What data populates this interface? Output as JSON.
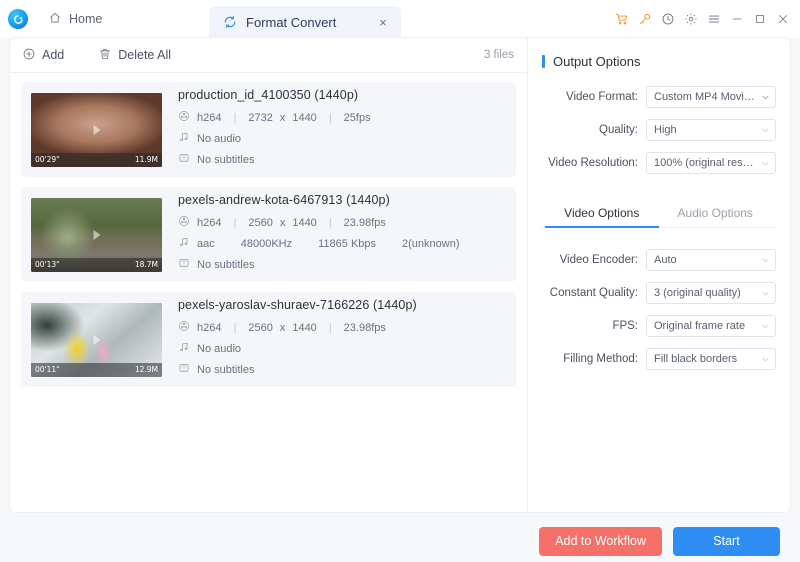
{
  "titlebar": {
    "logo_icon": "app-logo-icon",
    "home_label": "Home",
    "home_icon": "home-icon",
    "tab": {
      "icon": "convert-refresh-icon",
      "label": "Format Convert",
      "close_icon": "close-icon",
      "close_glyph": "×"
    },
    "window_icons": [
      {
        "name": "cart-icon",
        "color": "#f0922b"
      },
      {
        "name": "key-icon",
        "color": "#f0922b"
      },
      {
        "name": "history-clock-icon",
        "color": "#6a7180"
      },
      {
        "name": "gear-icon",
        "color": "#6a7180"
      },
      {
        "name": "menu-icon",
        "color": "#6a7180"
      },
      {
        "name": "minimize-icon",
        "color": "#6a7180"
      },
      {
        "name": "maximize-icon",
        "color": "#6a7180"
      },
      {
        "name": "window-close-icon",
        "color": "#6a7180"
      }
    ]
  },
  "toolbar": {
    "add_label": "Add",
    "add_icon": "plus-circle-icon",
    "delete_all_label": "Delete All",
    "delete_all_icon": "trash-icon",
    "file_count": "3 files"
  },
  "files": [
    {
      "name": "production_id_4100350 (1440p)",
      "duration": "00'29\"",
      "size": "11.9M",
      "video": {
        "codec": "h264",
        "width": "2732",
        "height": "1440",
        "fps": "25fps"
      },
      "audio_text": "No audio",
      "subtitle_text": "No subtitles",
      "thumb_colors": [
        "#1d1613",
        "#b08a76",
        "#4b2e22"
      ]
    },
    {
      "name": "pexels-andrew-kota-6467913 (1440p)",
      "duration": "00'13\"",
      "size": "18.7M",
      "video": {
        "codec": "h264",
        "width": "2560",
        "height": "1440",
        "fps": "23.98fps"
      },
      "audio": {
        "codec": "aac",
        "sample_rate": "48000KHz",
        "bitrate": "11865 Kbps",
        "channels": "2(unknown)"
      },
      "subtitle_text": "No subtitles",
      "thumb_colors": [
        "#4a5a3e",
        "#7d8d6a",
        "#2f3a28"
      ]
    },
    {
      "name": "pexels-yaroslav-shuraev-7166226 (1440p)",
      "duration": "00'11\"",
      "size": "12.9M",
      "video": {
        "codec": "h264",
        "width": "2560",
        "height": "1440",
        "fps": "23.98fps"
      },
      "audio_text": "No audio",
      "subtitle_text": "No subtitles",
      "thumb_colors": [
        "#cfd6d8",
        "#e3e7e8",
        "#8b9596"
      ]
    }
  ],
  "output_options": {
    "title": "Output Options",
    "fields": [
      {
        "label": "Video Format:",
        "value": "Custom MP4 Movie(..."
      },
      {
        "label": "Quality:",
        "value": "High"
      },
      {
        "label": "Video Resolution:",
        "value": "100% (original resol..."
      }
    ]
  },
  "option_tabs": [
    {
      "label": "Video Options",
      "active": true
    },
    {
      "label": "Audio Options",
      "active": false
    }
  ],
  "video_options": {
    "fields": [
      {
        "label": "Video Encoder:",
        "value": "Auto"
      },
      {
        "label": "Constant Quality:",
        "value": "3 (original quality)"
      },
      {
        "label": "FPS:",
        "value": "Original frame rate"
      },
      {
        "label": "Filling Method:",
        "value": "Fill black borders"
      }
    ]
  },
  "footer": {
    "add_to_workflow_label": "Add to Workflow",
    "start_label": "Start"
  },
  "colors": {
    "accent_blue": "#2f8ef4",
    "workflow_red": "#f47068",
    "orange_icon": "#f0922b",
    "card_bg": "#f5f6fa",
    "page_bg": "#f7f8fa"
  }
}
